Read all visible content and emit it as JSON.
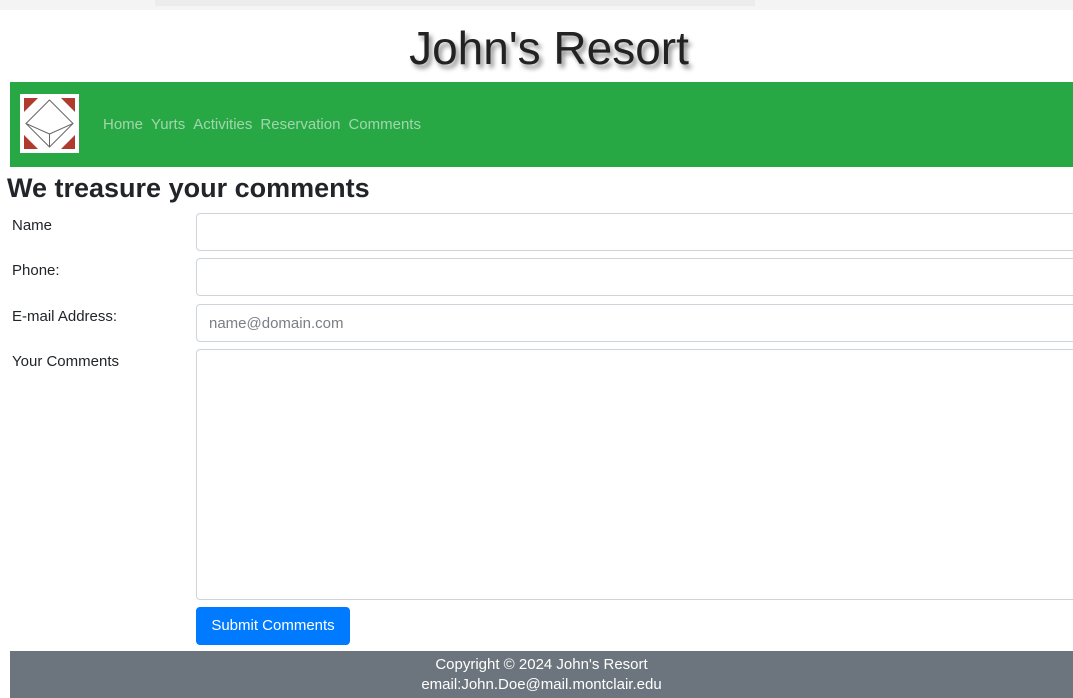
{
  "site": {
    "title": "John's Resort"
  },
  "navbar": {
    "background_color": "#28a745",
    "logo_icon": "cube-logo-icon",
    "links": [
      {
        "label": "Home"
      },
      {
        "label": "Yurts"
      },
      {
        "label": "Activities"
      },
      {
        "label": "Reservation"
      },
      {
        "label": "Comments"
      }
    ]
  },
  "form": {
    "heading": "We treasure your comments",
    "name_label": "Name",
    "name_value": "",
    "phone_label": "Phone:",
    "phone_value": "",
    "email_label": "E-mail Address:",
    "email_placeholder": "name@domain.com",
    "email_value": "",
    "comments_label": "Your Comments",
    "comments_value": "",
    "submit_label": "Submit Comments",
    "submit_color": "#007bff"
  },
  "footer": {
    "copyright": "Copyright © 2024 John's Resort",
    "email": "email:John.Doe@mail.montclair.edu",
    "background_color": "#6c757d"
  }
}
